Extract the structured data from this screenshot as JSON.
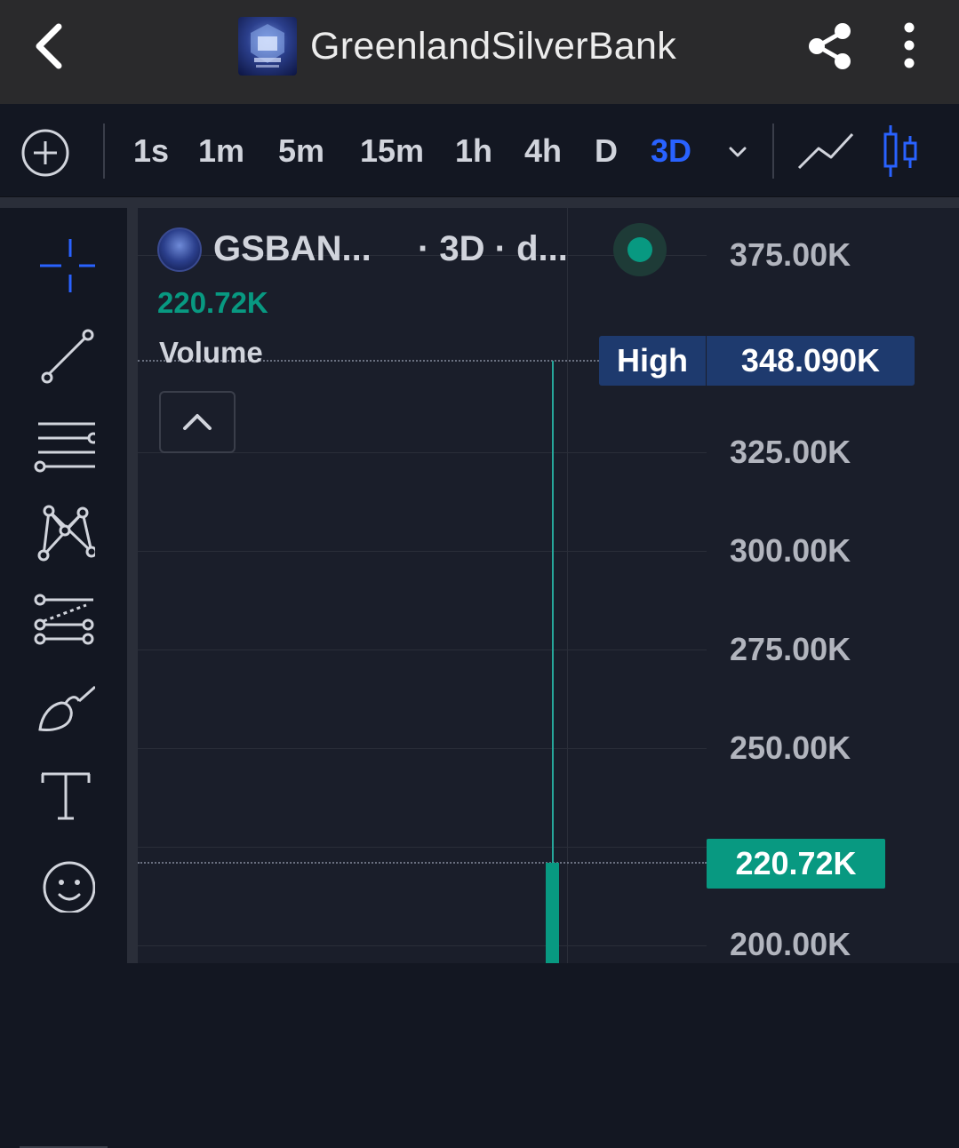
{
  "header": {
    "app_title": "GreenlandSilverBank",
    "back_icon": "chevron-left-icon",
    "share_icon": "share-icon",
    "more_icon": "more-vertical-icon"
  },
  "toolbar": {
    "add_icon": "plus-circle-icon",
    "timeframes": [
      "1s",
      "1m",
      "5m",
      "15m",
      "1h",
      "4h",
      "D",
      "3D"
    ],
    "active_timeframe": "3D",
    "dropdown_icon": "chevron-down-icon",
    "chart_type_icons": [
      "line-chart-icon",
      "candlestick-icon"
    ]
  },
  "sidebar": {
    "tools": [
      "crosshair-icon",
      "trend-line-icon",
      "horizontal-lines-icon",
      "pattern-icon",
      "fib-retracement-icon",
      "brush-icon",
      "text-icon",
      "emoji-icon"
    ]
  },
  "legend": {
    "symbol": "GSBAN...",
    "meta": "· 3D · d...",
    "price": "220.72K",
    "volume_label": "Volume"
  },
  "price_axis": {
    "ticks": [
      "375.00K",
      "325.00K",
      "300.00K",
      "275.00K",
      "250.00K",
      "200.00K"
    ],
    "high_label": "High",
    "high_value": "348.090K",
    "current_value": "220.72K"
  },
  "colors": {
    "background": "#131722",
    "accent": "#2962ff",
    "up": "#089981",
    "high_badge": "#1e3a6e"
  }
}
